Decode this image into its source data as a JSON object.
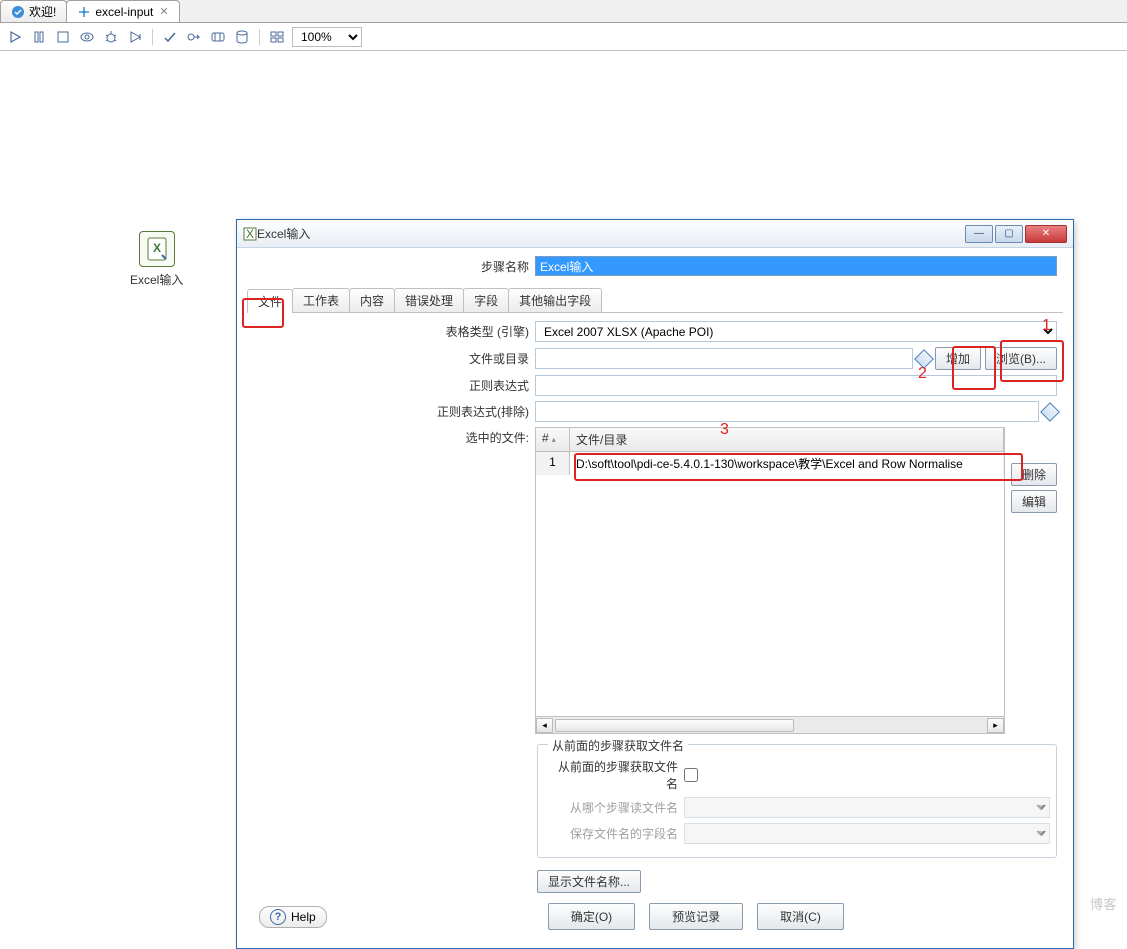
{
  "editorTabs": {
    "welcome": "欢迎!",
    "active": "excel-input"
  },
  "toolbar": {
    "zoom": "100%"
  },
  "nodeLabel": "Excel输入",
  "dialog": {
    "title": "Excel输入",
    "stepName": {
      "label": "步骤名称",
      "value": "Excel输入"
    },
    "tabs": [
      "文件",
      "工作表",
      "内容",
      "错误处理",
      "字段",
      "其他输出字段"
    ],
    "file": {
      "sheetTypeLabel": "表格类型 (引擎)",
      "sheetTypeValue": "Excel 2007 XLSX (Apache POI)",
      "fileOrDirLabel": "文件或目录",
      "addBtn": "增加",
      "browseBtn": "浏览(B)...",
      "regexLabel": "正则表达式",
      "regexExclLabel": "正则表达式(排除)",
      "selectedLabel": "选中的文件:",
      "tableHead": {
        "num": "#",
        "fileDir": "文件/目录"
      },
      "row": {
        "num": "1",
        "path": "D:\\soft\\tool\\pdi-ce-5.4.0.1-130\\workspace\\教学\\Excel and Row Normalise"
      },
      "delBtn": "删除",
      "editBtn": "编辑",
      "fsLegend": "从前面的步骤获取文件名",
      "fsAcceptLabel": "从前面的步骤获取文件名",
      "fsStepLabel": "从哪个步骤读文件名",
      "fsFieldLabel": "保存文件名的字段名",
      "showNamesBtn": "显示文件名称..."
    },
    "buttons": {
      "ok": "确定(O)",
      "preview": "预览记录",
      "cancel": "取消(C)",
      "help": "Help"
    }
  },
  "annotations": {
    "a1": "1",
    "a2": "2",
    "a3": "3"
  },
  "watermark": "博客"
}
